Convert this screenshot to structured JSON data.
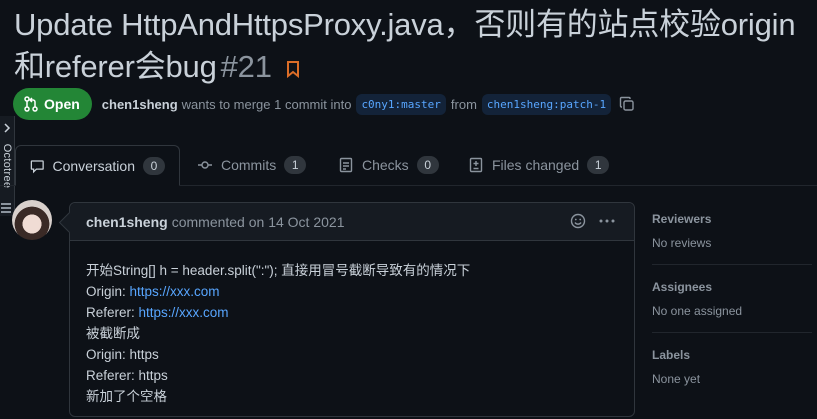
{
  "pr": {
    "title": "Update HttpAndHttpsProxy.java，否则有的站点校验origin和referer会bug",
    "number": "#21",
    "state": "Open",
    "author": "chen1sheng",
    "merge_text": "wants to merge 1 commit into",
    "base_branch": "c0ny1:master",
    "from_text": "from",
    "head_branch": "chen1sheng:patch-1"
  },
  "tabs": [
    {
      "label": "Conversation",
      "count": "0"
    },
    {
      "label": "Commits",
      "count": "1"
    },
    {
      "label": "Checks",
      "count": "0"
    },
    {
      "label": "Files changed",
      "count": "1"
    }
  ],
  "octotree": {
    "label": "Octotree"
  },
  "comment": {
    "author": "chen1sheng",
    "meta": "commented on 14 Oct 2021",
    "lines": {
      "l1": "开始String[] h = header.split(\":\"); 直接用冒号截断导致有的情况下",
      "l2_prefix": "Origin: ",
      "l2_link": "https://xxx.com",
      "l3_prefix": "Referer: ",
      "l3_link": "https://xxx.com",
      "l4": "被截断成",
      "l5": "Origin: https",
      "l6": "Referer: https",
      "l7": "新加了个空格"
    }
  },
  "sidebar": {
    "reviewers": {
      "title": "Reviewers",
      "value": "No reviews"
    },
    "assignees": {
      "title": "Assignees",
      "value": "No one assigned"
    },
    "labels": {
      "title": "Labels",
      "value": "None yet"
    }
  },
  "colors": {
    "background": "#0d1117",
    "open_green": "#238636",
    "link": "#58a6ff",
    "border": "#30363d"
  }
}
